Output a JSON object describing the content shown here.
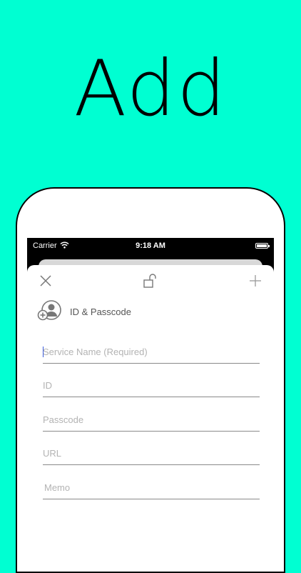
{
  "headline": "Add",
  "status_bar": {
    "carrier": "Carrier",
    "time": "9:18 AM"
  },
  "toolbar": {
    "close_icon": "close-icon",
    "lock_icon": "unlock-icon",
    "add_icon": "plus-icon"
  },
  "section": {
    "icon": "add-person-icon",
    "label": "ID & Passcode"
  },
  "fields": [
    {
      "placeholder": "Service Name (Required)",
      "value": ""
    },
    {
      "placeholder": "ID",
      "value": ""
    },
    {
      "placeholder": "Passcode",
      "value": ""
    },
    {
      "placeholder": "URL",
      "value": ""
    },
    {
      "placeholder": "Memo",
      "value": ""
    }
  ],
  "colors": {
    "background": "#00FFD2",
    "field_underline": "#8a8a8a",
    "placeholder": "#b3b3b3"
  }
}
